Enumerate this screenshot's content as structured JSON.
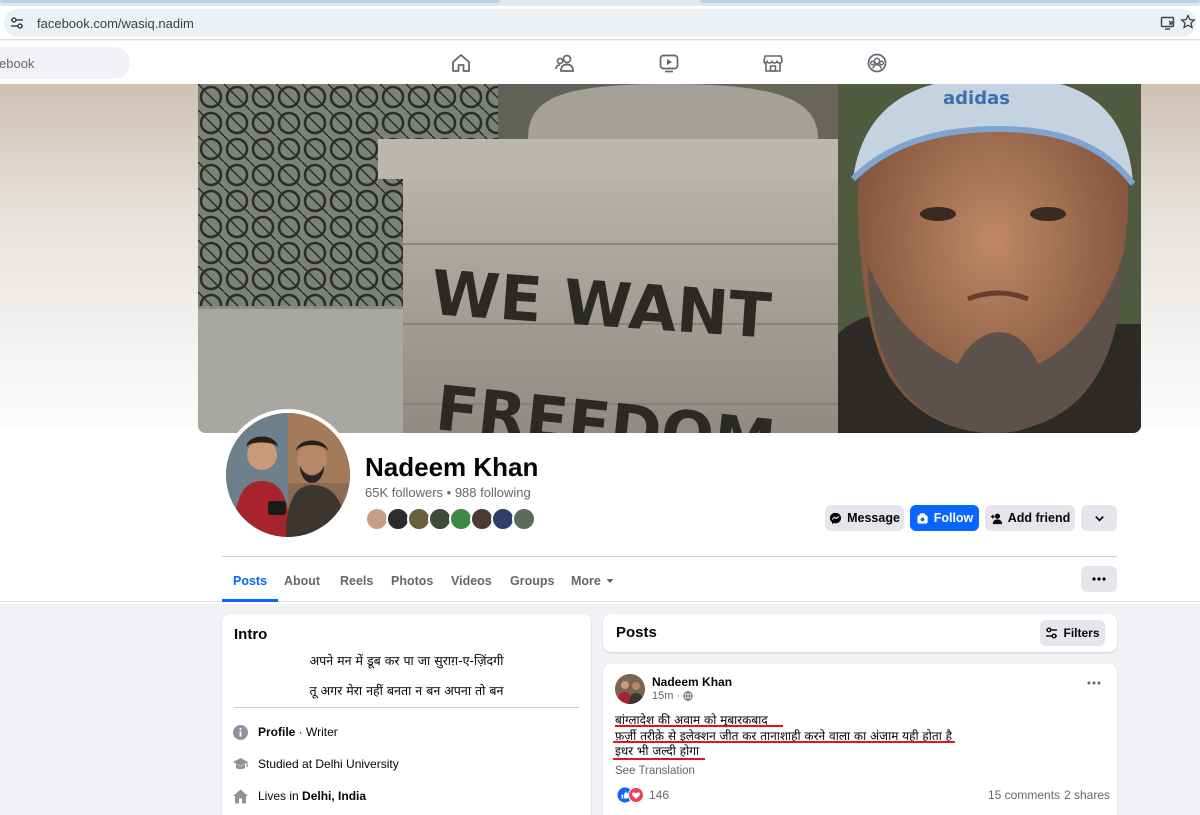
{
  "browser": {
    "url": "facebook.com/wasiq.nadim"
  },
  "nav": {
    "search_placeholder": "ebook",
    "icons": [
      "home-icon",
      "friends-icon",
      "video-icon",
      "marketplace-icon",
      "groups-icon"
    ]
  },
  "cover": {
    "graffiti_line1": "WE WANT",
    "graffiti_line2": "FREEDOM",
    "cap_text": "adidas"
  },
  "profile": {
    "name": "Nadeem Khan",
    "stats": "65K followers • 988 following",
    "buttons": {
      "message": "Message",
      "follow": "Follow",
      "add_friend": "Add friend"
    }
  },
  "tabs": [
    "Posts",
    "About",
    "Reels",
    "Photos",
    "Videos",
    "Groups",
    "More"
  ],
  "intro": {
    "title": "Intro",
    "bio_line1": "अपने मन में डूब कर पा जा सुराग़-ए-ज़िंदगी",
    "bio_line2": "तू अगर मेरा नहीं बनता न बन अपना तो बन",
    "profile_label": "Profile",
    "profile_suffix": " · Writer",
    "studied": "Studied at Delhi University",
    "lives_prefix": "Lives in ",
    "lives_place": "Delhi, India"
  },
  "posts": {
    "title": "Posts",
    "filters_label": "Filters",
    "post": {
      "author": "Nadeem Khan",
      "time": "15m · ",
      "line1": "बांग्लादेश की अवाम को मुबारकबाद",
      "line2": "फ़र्ज़ी तरीक़े से इलेक्शन जीत कर तानाशाही करने वाला का अंजाम यही होता है",
      "line3": "इधर भी जल्दी होगा",
      "see_translation": "See Translation",
      "reactions": "146",
      "comments": "15 comments",
      "shares": "2 shares"
    }
  },
  "colors": {
    "accent": "#0866ff",
    "underline": "#e8111f"
  }
}
